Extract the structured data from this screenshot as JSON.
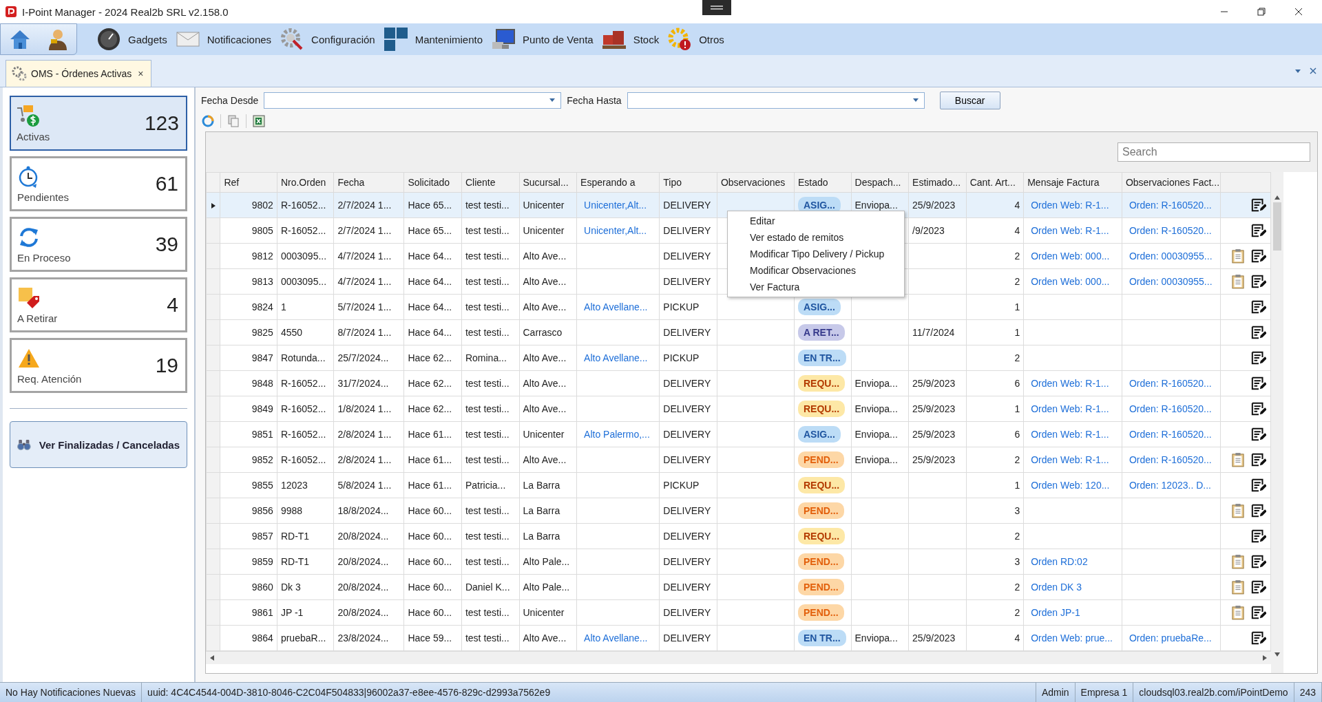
{
  "window": {
    "title": "I-Point Manager - 2024 Real2b SRL v2.158.0"
  },
  "ribbon": {
    "items": [
      {
        "label": "Gadgets"
      },
      {
        "label": "Notificaciones"
      },
      {
        "label": "Configuración"
      },
      {
        "label": "Mantenimiento"
      },
      {
        "label": "Punto de Venta"
      },
      {
        "label": "Stock"
      },
      {
        "label": "Otros"
      }
    ]
  },
  "tabs": [
    {
      "label": "OMS - Órdenes Activas",
      "close": "×",
      "selected": true
    }
  ],
  "summary": [
    {
      "label": "Activas",
      "count": "123",
      "selected": true
    },
    {
      "label": "Pendientes",
      "count": "61",
      "selected": false
    },
    {
      "label": "En Proceso",
      "count": "39",
      "selected": false
    },
    {
      "label": "A Retirar",
      "count": "4",
      "selected": false
    },
    {
      "label": "Req. Atención",
      "count": "19",
      "selected": false
    }
  ],
  "finished_button": "Ver Finalizadas / Canceladas",
  "filters": {
    "from_label": "Fecha Desde",
    "to_label": "Fecha Hasta",
    "search_button": "Buscar"
  },
  "search": {
    "placeholder": "Search"
  },
  "table": {
    "columns": [
      "Ref",
      "Nro.Orden",
      "Fecha",
      "Solicitado",
      "Cliente",
      "Sucursal...",
      "Esperando a",
      "Tipo",
      "Observaciones",
      "Estado",
      "Despach...",
      "Estimado...",
      "Cant. Art...",
      "Mensaje Factura",
      "Observaciones Fact..."
    ],
    "rows": [
      {
        "selected": true,
        "ref": "9802",
        "orden": "R-16052...",
        "fecha": "2/7/2024 1...",
        "solicitado": "Hace 65...",
        "cliente": "test testi...",
        "sucursal": "Unicenter",
        "esperando": "Unicenter,Alt...",
        "tipo": "DELIVERY",
        "estado": {
          "label": "ASIG...",
          "kind": "asig"
        },
        "despacho": "Enviopa...",
        "estimado": "25/9/2023",
        "cant": "4",
        "mensaje": "Orden Web: R-1...",
        "obs_factura": "Orden: R-160520...",
        "clipboard": false
      },
      {
        "selected": false,
        "ref": "9805",
        "orden": "R-16052...",
        "fecha": "2/7/2024 1...",
        "solicitado": "Hace 65...",
        "cliente": "test testi...",
        "sucursal": "Unicenter",
        "esperando": "Unicenter,Alt...",
        "tipo": "DELIVERY",
        "estimado": "/9/2023",
        "cant": "4",
        "mensaje": "Orden Web: R-1...",
        "obs_factura": "Orden: R-160520...",
        "clipboard": false
      },
      {
        "selected": false,
        "ref": "9812",
        "orden": "0003095...",
        "fecha": "4/7/2024 1...",
        "solicitado": "Hace 64...",
        "cliente": "test testi...",
        "sucursal": "Alto Ave...",
        "tipo": "DELIVERY",
        "cant": "2",
        "mensaje": "Orden Web: 000...",
        "obs_factura": "Orden: 00030955...",
        "clipboard": true
      },
      {
        "selected": false,
        "ref": "9813",
        "orden": "0003095...",
        "fecha": "4/7/2024 1...",
        "solicitado": "Hace 64...",
        "cliente": "test testi...",
        "sucursal": "Alto Ave...",
        "tipo": "DELIVERY",
        "cant": "2",
        "mensaje": "Orden Web: 000...",
        "obs_factura": "Orden: 00030955...",
        "clipboard": true
      },
      {
        "selected": false,
        "ref": "9824",
        "orden": "1",
        "fecha": "5/7/2024 1...",
        "solicitado": "Hace 64...",
        "cliente": "test testi...",
        "sucursal": "Alto Ave...",
        "esperando": "Alto Avellane...",
        "tipo": "PICKUP",
        "estado": {
          "label": "ASIG...",
          "kind": "asig"
        },
        "cant": "1",
        "clipboard": false
      },
      {
        "selected": false,
        "ref": "9825",
        "orden": "4550",
        "fecha": "8/7/2024 1...",
        "solicitado": "Hace 64...",
        "cliente": "test testi...",
        "sucursal": "Carrasco",
        "tipo": "DELIVERY",
        "estado": {
          "label": "A RET...",
          "kind": "retirar"
        },
        "estimado": "11/7/2024",
        "cant": "1",
        "clipboard": false
      },
      {
        "selected": false,
        "ref": "9847",
        "orden": "Rotunda...",
        "fecha": "25/7/2024...",
        "solicitado": "Hace 62...",
        "cliente": "Romina...",
        "sucursal": "Alto Ave...",
        "esperando": "Alto Avellane...",
        "tipo": "PICKUP",
        "estado": {
          "label": "EN TR...",
          "kind": "transito"
        },
        "cant": "2",
        "clipboard": false
      },
      {
        "selected": false,
        "ref": "9848",
        "orden": "R-16052...",
        "fecha": "31/7/2024...",
        "solicitado": "Hace 62...",
        "cliente": "test testi...",
        "sucursal": "Alto Ave...",
        "tipo": "DELIVERY",
        "estado": {
          "label": "REQU...",
          "kind": "requiere"
        },
        "despacho": "Enviopa...",
        "estimado": "25/9/2023",
        "cant": "6",
        "mensaje": "Orden Web: R-1...",
        "obs_factura": "Orden: R-160520...",
        "clipboard": false
      },
      {
        "selected": false,
        "ref": "9849",
        "orden": "R-16052...",
        "fecha": "1/8/2024 1...",
        "solicitado": "Hace 62...",
        "cliente": "test testi...",
        "sucursal": "Alto Ave...",
        "tipo": "DELIVERY",
        "estado": {
          "label": "REQU...",
          "kind": "requiere"
        },
        "despacho": "Enviopa...",
        "estimado": "25/9/2023",
        "cant": "1",
        "mensaje": "Orden Web: R-1...",
        "obs_factura": "Orden: R-160520...",
        "clipboard": false
      },
      {
        "selected": false,
        "ref": "9851",
        "orden": "R-16052...",
        "fecha": "2/8/2024 1...",
        "solicitado": "Hace 61...",
        "cliente": "test testi...",
        "sucursal": "Unicenter",
        "esperando": "Alto Palermo,...",
        "tipo": "DELIVERY",
        "estado": {
          "label": "ASIG...",
          "kind": "asig"
        },
        "despacho": "Enviopa...",
        "estimado": "25/9/2023",
        "cant": "6",
        "mensaje": "Orden Web: R-1...",
        "obs_factura": "Orden: R-160520...",
        "clipboard": false
      },
      {
        "selected": false,
        "ref": "9852",
        "orden": "R-16052...",
        "fecha": "2/8/2024 1...",
        "solicitado": "Hace 61...",
        "cliente": "test testi...",
        "sucursal": "Alto Ave...",
        "tipo": "DELIVERY",
        "estado": {
          "label": "PEND...",
          "kind": "pendiente"
        },
        "despacho": "Enviopa...",
        "estimado": "25/9/2023",
        "cant": "2",
        "mensaje": "Orden Web: R-1...",
        "obs_factura": "Orden: R-160520...",
        "clipboard": true
      },
      {
        "selected": false,
        "ref": "9855",
        "orden": "12023",
        "fecha": "5/8/2024 1...",
        "solicitado": "Hace 61...",
        "cliente": "Patricia...",
        "sucursal": "La Barra",
        "tipo": "PICKUP",
        "estado": {
          "label": "REQU...",
          "kind": "requiere"
        },
        "cant": "1",
        "mensaje": "Orden Web: 120...",
        "obs_factura": "Orden: 12023.. D...",
        "clipboard": false
      },
      {
        "selected": false,
        "ref": "9856",
        "orden": "9988",
        "fecha": "18/8/2024...",
        "solicitado": "Hace 60...",
        "cliente": "test testi...",
        "sucursal": "La Barra",
        "tipo": "DELIVERY",
        "estado": {
          "label": "PEND...",
          "kind": "pendiente"
        },
        "cant": "3",
        "clipboard": true
      },
      {
        "selected": false,
        "ref": "9857",
        "orden": "RD-T1",
        "fecha": "20/8/2024...",
        "solicitado": "Hace 60...",
        "cliente": "test testi...",
        "sucursal": "La Barra",
        "tipo": "DELIVERY",
        "estado": {
          "label": "REQU...",
          "kind": "requiere"
        },
        "cant": "2",
        "clipboard": false
      },
      {
        "selected": false,
        "ref": "9859",
        "orden": "RD-T1",
        "fecha": "20/8/2024...",
        "solicitado": "Hace 60...",
        "cliente": "test testi...",
        "sucursal": "Alto Pale...",
        "tipo": "DELIVERY",
        "estado": {
          "label": "PEND...",
          "kind": "pendiente"
        },
        "cant": "3",
        "mensaje": "Orden RD:02",
        "clipboard": true
      },
      {
        "selected": false,
        "ref": "9860",
        "orden": "Dk 3",
        "fecha": "20/8/2024...",
        "solicitado": "Hace 60...",
        "cliente": "Daniel K...",
        "sucursal": "Alto Pale...",
        "tipo": "DELIVERY",
        "estado": {
          "label": "PEND...",
          "kind": "pendiente"
        },
        "cant": "2",
        "mensaje": "Orden DK 3",
        "clipboard": true
      },
      {
        "selected": false,
        "ref": "9861",
        "orden": "JP -1",
        "fecha": "20/8/2024...",
        "solicitado": "Hace 60...",
        "cliente": "test testi...",
        "sucursal": "Unicenter",
        "tipo": "DELIVERY",
        "estado": {
          "label": "PEND...",
          "kind": "pendiente"
        },
        "cant": "2",
        "mensaje": "Orden JP-1",
        "clipboard": true
      },
      {
        "selected": false,
        "ref": "9864",
        "orden": "pruebaR...",
        "fecha": "23/8/2024...",
        "solicitado": "Hace 59...",
        "cliente": "test testi...",
        "sucursal": "Alto Ave...",
        "esperando": "Alto Avellane...",
        "tipo": "DELIVERY",
        "estado": {
          "label": "EN TR...",
          "kind": "transito"
        },
        "despacho": "Enviopa...",
        "estimado": "25/9/2023",
        "cant": "4",
        "mensaje": "Orden Web: prue...",
        "obs_factura": "Orden: pruebaRe...",
        "clipboard": false
      }
    ]
  },
  "context_menu": [
    "Editar",
    "Ver estado de remitos",
    "Modificar Tipo Delivery / Pickup",
    "Modificar Observaciones",
    "Ver Factura"
  ],
  "status_bar": [
    "No Hay Notificaciones Nuevas",
    "uuid: 4C4C4544-004D-3810-8046-C2C04F504833|96002a37-e8ee-4576-829c-d2993a7562e9",
    "Admin",
    "Empresa 1",
    "cloudsql03.real2b.com/iPointDemo",
    "243"
  ]
}
